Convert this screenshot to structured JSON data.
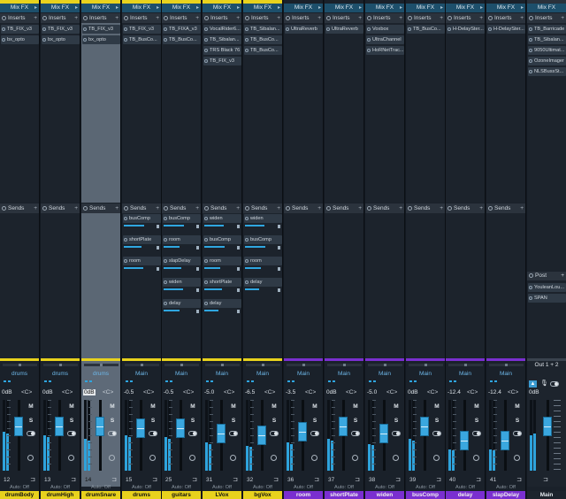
{
  "ui": {
    "mixfx": "Mix FX",
    "inserts": "Inserts",
    "sends": "Sends",
    "post": "Post",
    "auto": "Auto: Off",
    "center": "<C>",
    "mute": "M",
    "solo": "S",
    "plus": "+",
    "arrow": "▸",
    "io": "⊐"
  },
  "colors": {
    "accent": "#2fa6e0",
    "yellow": "#e8d21d",
    "purple": "#7a2fd0",
    "mixfx_bg": "#1d4f6b"
  },
  "channels": [
    {
      "name": "drumBody",
      "dest": "drums",
      "vol": "0dB",
      "num": "12",
      "color": "#e8d21d",
      "fader": 0.62,
      "meter": 0.55,
      "inserts": [
        "TB_FIX_v3",
        "bx_opto"
      ],
      "sends": []
    },
    {
      "name": "drumHigh",
      "dest": "drums",
      "vol": "0dB",
      "num": "13",
      "color": "#e8d21d",
      "fader": 0.62,
      "meter": 0.5,
      "inserts": [
        "TB_FIX_v3",
        "bx_opto"
      ],
      "sends": []
    },
    {
      "name": "drumSnare",
      "dest": "drums",
      "vol": "0dB",
      "num": "14",
      "color": "#e8d21d",
      "fader": 0.62,
      "meter": 0.45,
      "selected": true,
      "inserts": [
        "TB_FIX_v3",
        "bx_opto"
      ],
      "sends": []
    },
    {
      "name": "drums",
      "dest": "Main",
      "vol": "-0.5",
      "num": "15",
      "color": "#e8d21d",
      "fader": 0.6,
      "meter": 0.5,
      "inserts": [
        "TB_FIX_v3",
        "TB_BusCo..."
      ],
      "sends": [
        {
          "label": "busComp",
          "level": 0.65
        },
        {
          "label": "shortPlate",
          "level": 0.55
        },
        {
          "label": "room",
          "level": 0.6
        }
      ]
    },
    {
      "name": "guitars",
      "dest": "Main",
      "vol": "-0.5",
      "num": "25",
      "color": "#e8d21d",
      "fader": 0.6,
      "meter": 0.48,
      "inserts": [
        "TB_FIXA_v3",
        "TB_BusCo..."
      ],
      "sends": [
        {
          "label": "busComp",
          "level": 0.65
        },
        {
          "label": "room",
          "level": 0.5
        },
        {
          "label": "slapDelay",
          "level": 0.55
        },
        {
          "label": "widen",
          "level": 0.6
        },
        {
          "label": "delay",
          "level": 0.5
        }
      ]
    },
    {
      "name": "LVox",
      "dest": "Main",
      "vol": "-5.0",
      "num": "31",
      "color": "#e8d21d",
      "fader": 0.52,
      "meter": 0.4,
      "inserts": [
        "VocalRider6...",
        "TB_Sibalan...",
        "TRS Black 76",
        "TB_FIX_v3"
      ],
      "sends": [
        {
          "label": "widen",
          "level": 0.6
        },
        {
          "label": "busComp",
          "level": 0.65
        },
        {
          "label": "room",
          "level": 0.5
        },
        {
          "label": "shortPlate",
          "level": 0.55
        },
        {
          "label": "delay",
          "level": 0.45
        }
      ]
    },
    {
      "name": "bgVox",
      "dest": "Main",
      "vol": "-6.5",
      "num": "32",
      "color": "#e8d21d",
      "fader": 0.5,
      "meter": 0.35,
      "inserts": [
        "TB_Sibalan...",
        "TB_BusCo...",
        "TB_BusCo..."
      ],
      "sends": [
        {
          "label": "widen",
          "level": 0.6
        },
        {
          "label": "busComp",
          "level": 0.65
        },
        {
          "label": "room",
          "level": 0.5
        },
        {
          "label": "delay",
          "level": 0.45
        }
      ]
    },
    {
      "name": "room",
      "dest": "Main",
      "vol": "-3.5",
      "num": "36",
      "color": "#7a2fd0",
      "fader": 0.55,
      "meter": 0.4,
      "inserts": [
        "UltraReverb"
      ],
      "sends": []
    },
    {
      "name": "shortPlate",
      "dest": "Main",
      "vol": "0dB",
      "num": "37",
      "color": "#7a2fd0",
      "fader": 0.62,
      "meter": 0.45,
      "inserts": [
        "UltraReverb"
      ],
      "sends": []
    },
    {
      "name": "widen",
      "dest": "Main",
      "vol": "-5.0",
      "num": "38",
      "color": "#7a2fd0",
      "fader": 0.52,
      "meter": 0.38,
      "inserts": [
        "Voxbox",
        "UltraChannel",
        "HoRNetTrac..."
      ],
      "sends": []
    },
    {
      "name": "busComp",
      "dest": "Main",
      "vol": "0dB",
      "num": "39",
      "color": "#7a2fd0",
      "fader": 0.62,
      "meter": 0.45,
      "inserts": [
        "TB_BusCo..."
      ],
      "sends": []
    },
    {
      "name": "delay",
      "dest": "Main",
      "vol": "-12.4",
      "num": "40",
      "color": "#7a2fd0",
      "fader": 0.42,
      "meter": 0.3,
      "inserts": [
        "H-DelaySter..."
      ],
      "sends": []
    },
    {
      "name": "slapDelay",
      "dest": "Main",
      "vol": "-12.4",
      "num": "41",
      "color": "#7a2fd0",
      "fader": 0.42,
      "meter": 0.3,
      "inserts": [
        "H-DelaySter..."
      ],
      "sends": []
    }
  ],
  "main": {
    "name": "Main",
    "dest": "Out 1 + 2",
    "vol": "0dB",
    "mixfx": "Mix FX",
    "fader": 0.62,
    "inserts": [
      "TB_Barricade",
      "TB_Sibalan...",
      "9050Ultimat...",
      "OzoneImager",
      "NLSBussSt..."
    ],
    "post_inserts": [
      "YouleanLou...",
      "SPAN"
    ]
  }
}
